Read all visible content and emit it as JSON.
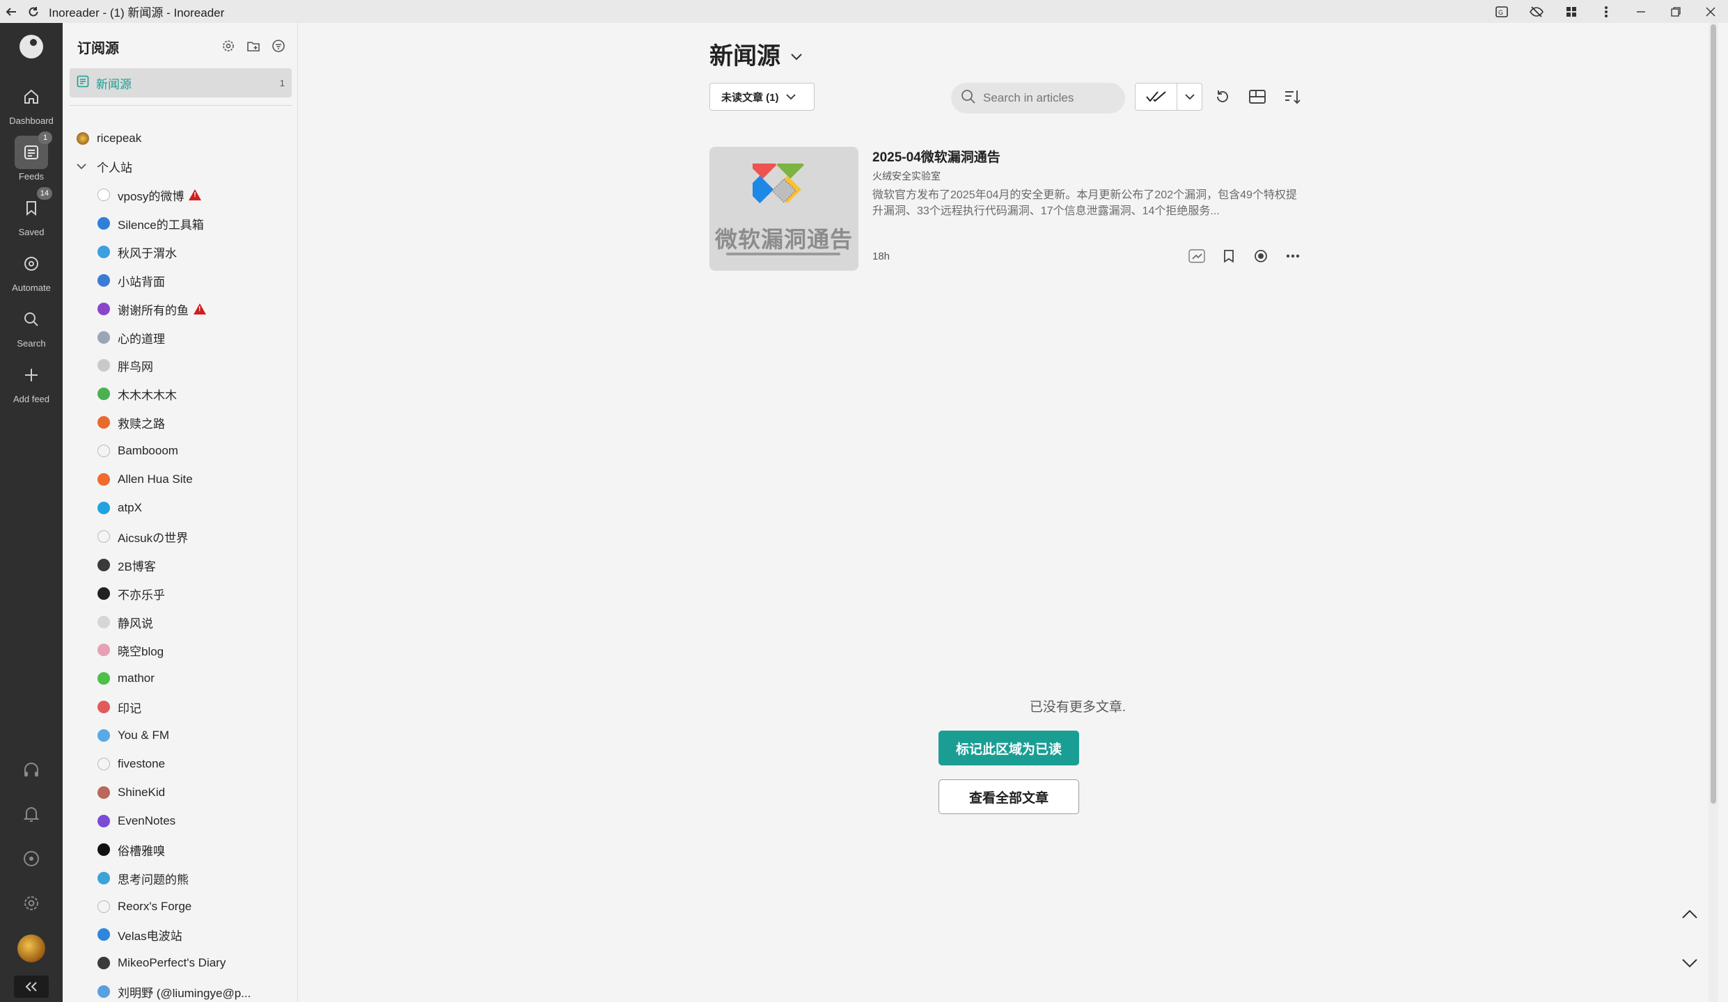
{
  "window": {
    "title": "Inoreader - (1) 新闻源 - Inoreader"
  },
  "rail": {
    "items": [
      {
        "label": "Dashboard",
        "icon": "home-icon"
      },
      {
        "label": "Feeds",
        "icon": "feeds-icon",
        "badge": "1"
      },
      {
        "label": "Saved",
        "icon": "bookmark-icon",
        "badge": "14"
      },
      {
        "label": "Automate",
        "icon": "automate-icon"
      },
      {
        "label": "Search",
        "icon": "search-icon"
      },
      {
        "label": "Add feed",
        "icon": "plus-icon"
      }
    ]
  },
  "sidebar": {
    "title": "订阅源",
    "all": {
      "label": "新闻源",
      "count": "1"
    },
    "top_feed": "ricepeak",
    "folder": "个人站",
    "feeds": [
      {
        "name": "vposy的微博",
        "warning": true,
        "color": "#ffffff"
      },
      {
        "name": "Silence的工具箱",
        "warning": false,
        "color": "#2f7fd8"
      },
      {
        "name": "秋风于渭水",
        "warning": false,
        "color": "#3aa0e0"
      },
      {
        "name": "小站背面",
        "warning": false,
        "color": "#3a7bd5"
      },
      {
        "name": "谢谢所有的鱼",
        "warning": true,
        "color": "#8a46c9"
      },
      {
        "name": "心的道理",
        "warning": false,
        "color": "#9aa6b8"
      },
      {
        "name": "胖鸟网",
        "warning": false,
        "color": "#c9c9c9"
      },
      {
        "name": "木木木木木",
        "warning": false,
        "color": "#4caf50"
      },
      {
        "name": "救赎之路",
        "warning": false,
        "color": "#e96a2b"
      },
      {
        "name": "Bambooom",
        "warning": false,
        "color": "#f4f4f4"
      },
      {
        "name": "Allen Hua Site",
        "warning": false,
        "color": "#ee6b2e"
      },
      {
        "name": "atpX",
        "warning": false,
        "color": "#1fa3e0"
      },
      {
        "name": "Aicsukの世界",
        "warning": false,
        "color": "#f4f4f4"
      },
      {
        "name": "2B博客",
        "warning": false,
        "color": "#3a3a3a"
      },
      {
        "name": "不亦乐乎",
        "warning": false,
        "color": "#222222"
      },
      {
        "name": "静风说",
        "warning": false,
        "color": "#d6d6d6"
      },
      {
        "name": "晓空blog",
        "warning": false,
        "color": "#e8a0b4"
      },
      {
        "name": "mathor",
        "warning": false,
        "color": "#4fbf4a"
      },
      {
        "name": "印记",
        "warning": false,
        "color": "#e25b5b"
      },
      {
        "name": "You & FM",
        "warning": false,
        "color": "#5aa9e6"
      },
      {
        "name": "fivestone",
        "warning": false,
        "color": "#f4f4f4"
      },
      {
        "name": "ShineKid",
        "warning": false,
        "color": "#b9685a"
      },
      {
        "name": "EvenNotes",
        "warning": false,
        "color": "#7b4bd6"
      },
      {
        "name": "俗槽雅嗅",
        "warning": false,
        "color": "#111111"
      },
      {
        "name": "思考问题的熊",
        "warning": false,
        "color": "#3ba3d8"
      },
      {
        "name": "Reorx's Forge",
        "warning": false,
        "color": "#f4f4f4"
      },
      {
        "name": "Velas电波站",
        "warning": false,
        "color": "#2e86de"
      },
      {
        "name": "MikeoPerfect's Diary",
        "warning": false,
        "color": "#3a3a3a"
      },
      {
        "name": "刘明野 (@liumingye@p...",
        "warning": false,
        "color": "#5aa0e0"
      }
    ]
  },
  "main": {
    "title": "新闻源",
    "filter": "未读文章 (1)",
    "search_placeholder": "Search in articles",
    "article": {
      "title": "2025-04微软漏洞通告",
      "source": "火绒安全实验室",
      "excerpt": "微软官方发布了2025年04月的安全更新。本月更新公布了202个漏洞，包含49个特权提升漏洞、33个远程执行代码漏洞、17个信息泄露漏洞、14个拒绝服务...",
      "time": "18h",
      "thumb_text": "微软漏洞通告"
    },
    "no_more": "已没有更多文章.",
    "mark_read_button": "标记此区域为已读",
    "view_all_button": "查看全部文章"
  },
  "colors": {
    "accent": "#1a9e94",
    "rail_bg": "#2f2f2f",
    "warning": "#d11f1f"
  }
}
